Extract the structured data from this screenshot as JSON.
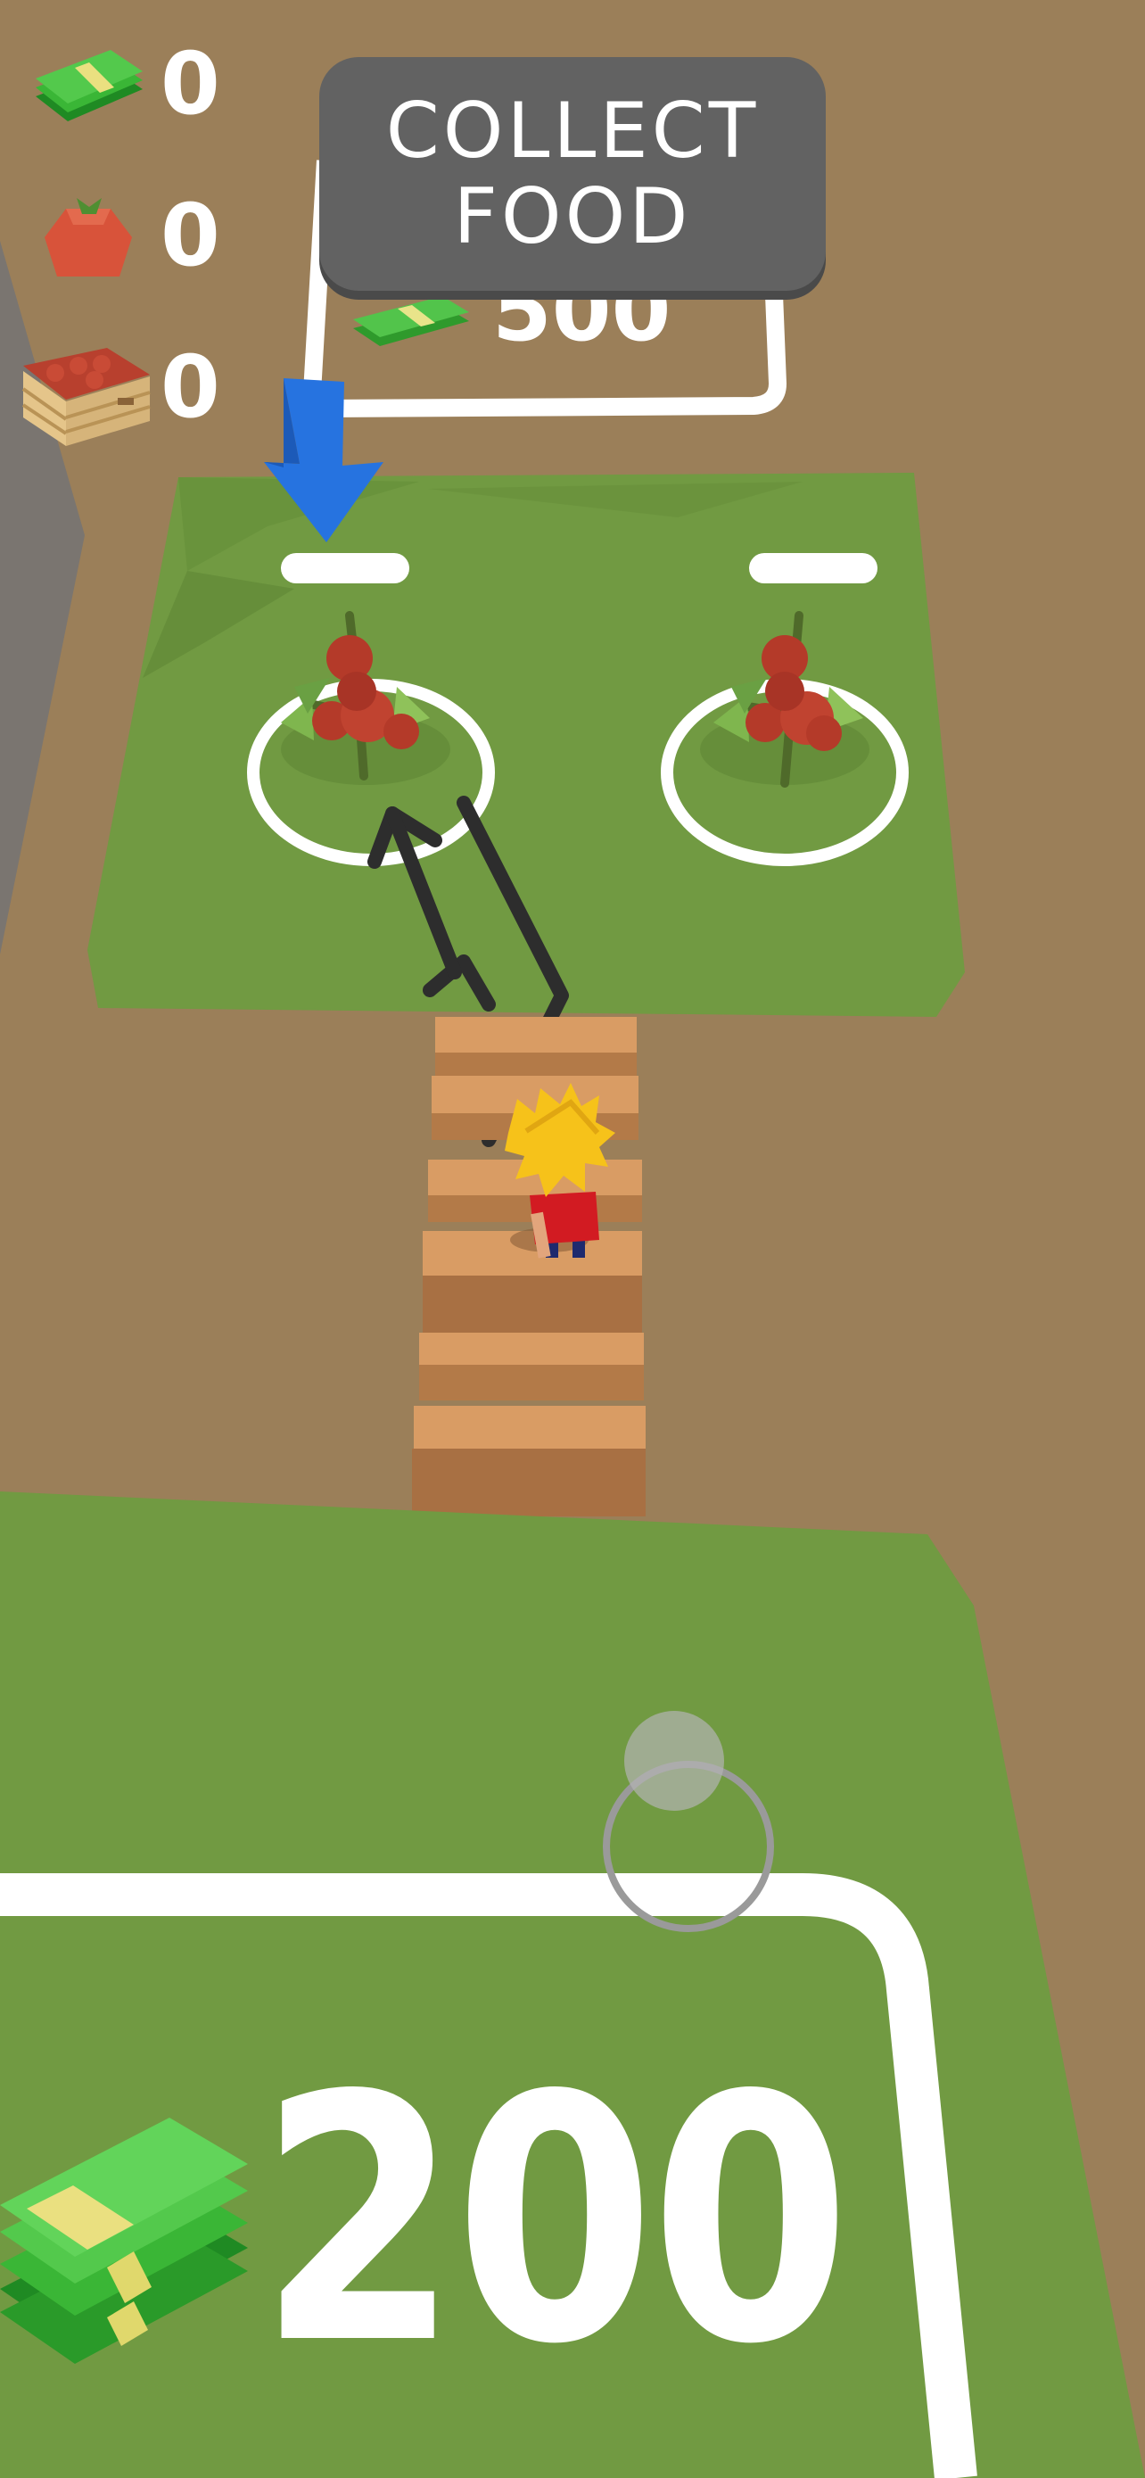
{
  "hud": {
    "money_count": "0",
    "tomato_count": "0",
    "crate_count": "0"
  },
  "banner": {
    "line1": "COLLECT",
    "line2": "FOOD"
  },
  "unlock_zones": {
    "top_price": "500",
    "bottom_price": "200"
  },
  "icons": {
    "money": "cash-stack-icon",
    "tomato": "tomato-icon",
    "crate": "tomato-crate-icon",
    "guide_arrow": "down-arrow-icon",
    "joystick": "joystick-icon"
  },
  "colors": {
    "ground": "#9b7f59",
    "grass": "#719a42",
    "banner": "#626262",
    "guide_arrow": "#2673e0",
    "cash": "#4fc24a"
  }
}
